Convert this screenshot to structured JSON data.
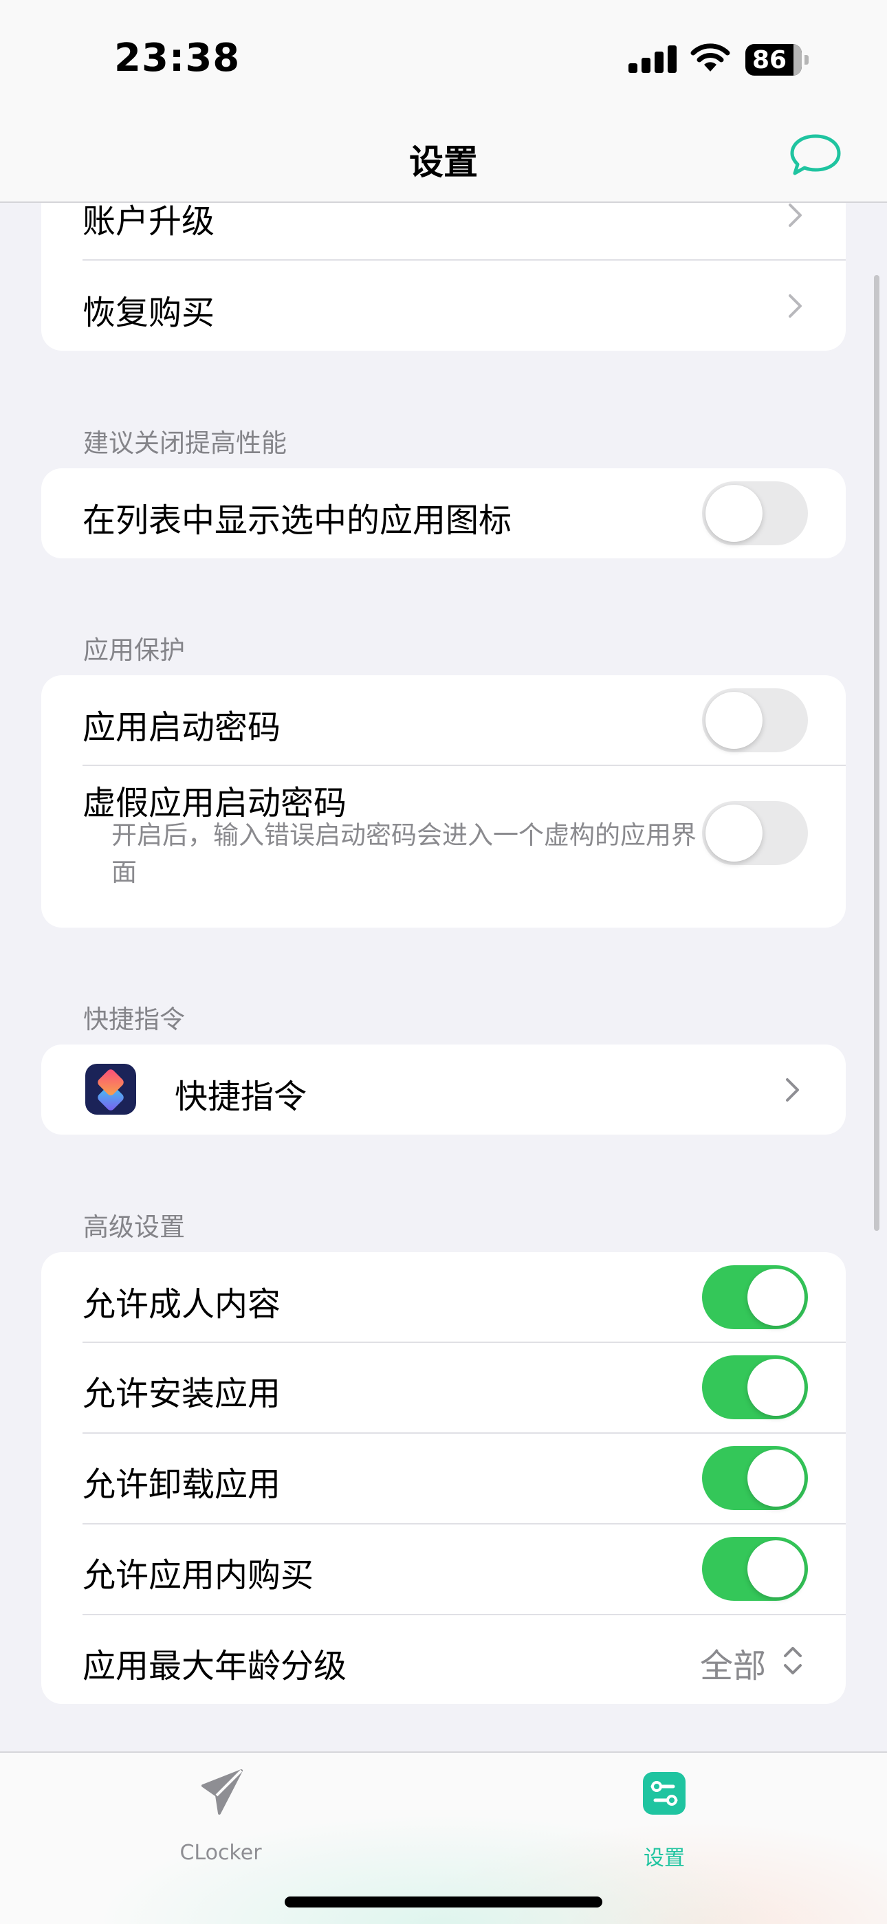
{
  "status_bar": {
    "time": "23:38",
    "battery": "86"
  },
  "nav": {
    "title": "设置",
    "chat_icon": "chat-bubble-icon"
  },
  "account_group": {
    "items": [
      {
        "label": "账户升级"
      },
      {
        "label": "恢复购买"
      }
    ]
  },
  "performance": {
    "header": "建议关闭提高性能",
    "items": [
      {
        "label": "在列表中显示选中的应用图标",
        "toggle": false
      }
    ]
  },
  "protection": {
    "header": "应用保护",
    "items": [
      {
        "label": "应用启动密码",
        "toggle": false
      },
      {
        "label": "虚假应用启动密码",
        "subtitle": "开启后，输入错误启动密码会进入一个虚构的应用界面",
        "toggle": false
      }
    ]
  },
  "shortcuts": {
    "header": "快捷指令",
    "items": [
      {
        "label": "快捷指令",
        "icon": "shortcuts-app-icon"
      }
    ]
  },
  "advanced": {
    "header": "高级设置",
    "items": [
      {
        "label": "允许成人内容",
        "toggle": true
      },
      {
        "label": "允许安装应用",
        "toggle": true
      },
      {
        "label": "允许卸载应用",
        "toggle": true
      },
      {
        "label": "允许应用内购买",
        "toggle": true
      },
      {
        "label": "应用最大年龄分级",
        "value": "全部"
      }
    ]
  },
  "tabbar": {
    "tabs": [
      {
        "label": "CLocker",
        "icon": "paper-plane-icon",
        "active": false
      },
      {
        "label": "设置",
        "icon": "settings-sliders-icon",
        "active": true
      }
    ]
  },
  "colors": {
    "accent": "#1fc4a0",
    "toggle_on": "#34c759",
    "toggle_off": "#e9e9ea",
    "background": "#f2f2f7",
    "inactive_tab": "#8e8e93"
  }
}
